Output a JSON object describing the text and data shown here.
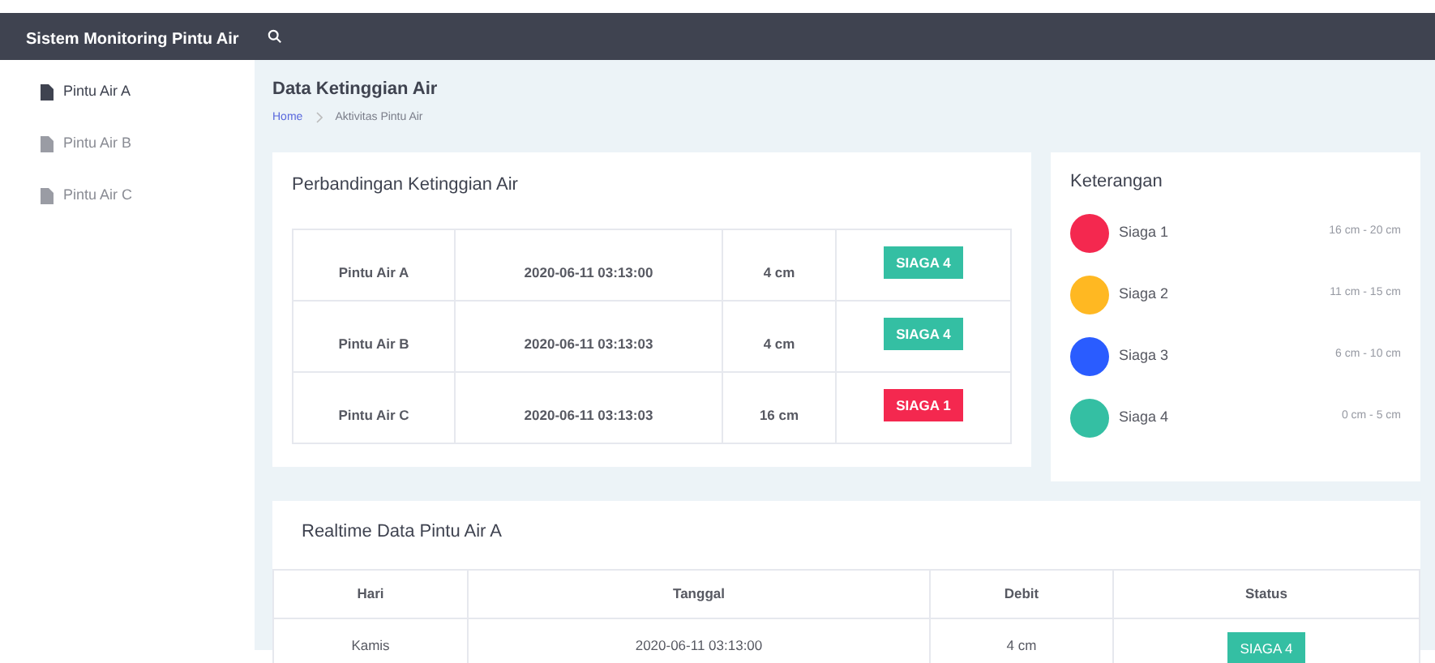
{
  "navbar": {
    "title": "Sistem Monitoring Pintu Air"
  },
  "sidebar": {
    "items": [
      {
        "label": "Pintu Air A",
        "selected": true
      },
      {
        "label": "Pintu Air B",
        "selected": false
      },
      {
        "label": "Pintu Air C",
        "selected": false
      }
    ]
  },
  "page": {
    "title": "Data Ketinggian Air",
    "breadcrumb": [
      "Home",
      "Aktivitas Pintu Air"
    ]
  },
  "comparison": {
    "title": "Perbandingan Ketinggian Air",
    "rows": [
      {
        "name": "Pintu Air A",
        "time": "2020-06-11 03:13:00",
        "level": "4 cm",
        "status": "SIAGA 4",
        "color": "#34bfa3"
      },
      {
        "name": "Pintu Air B",
        "time": "2020-06-11 03:13:03",
        "level": "4 cm",
        "status": "SIAGA 4",
        "color": "#34bfa3"
      },
      {
        "name": "Pintu Air C",
        "time": "2020-06-11 03:13:03",
        "level": "16 cm",
        "status": "SIAGA 1",
        "color": "#f4284f"
      }
    ]
  },
  "legend": {
    "title": "Keterangan",
    "items": [
      {
        "label": "Siaga 1",
        "range": "16 cm - 20 cm",
        "color": "#f4284f"
      },
      {
        "label": "Siaga 2",
        "range": "11 cm - 15 cm",
        "color": "#ffb822"
      },
      {
        "label": "Siaga 3",
        "range": "6 cm - 10 cm",
        "color": "#2a5cff"
      },
      {
        "label": "Siaga 4",
        "range": "0 cm - 5 cm",
        "color": "#34bfa3"
      }
    ]
  },
  "realtime": {
    "title": "Realtime Data Pintu Air A",
    "columns": [
      "Hari",
      "Tanggal",
      "Debit",
      "Status"
    ],
    "rows": [
      {
        "day": "Kamis",
        "date": "2020-06-11 03:13:00",
        "debit": "4 cm",
        "status": "SIAGA 4",
        "color": "#34bfa3"
      }
    ]
  }
}
